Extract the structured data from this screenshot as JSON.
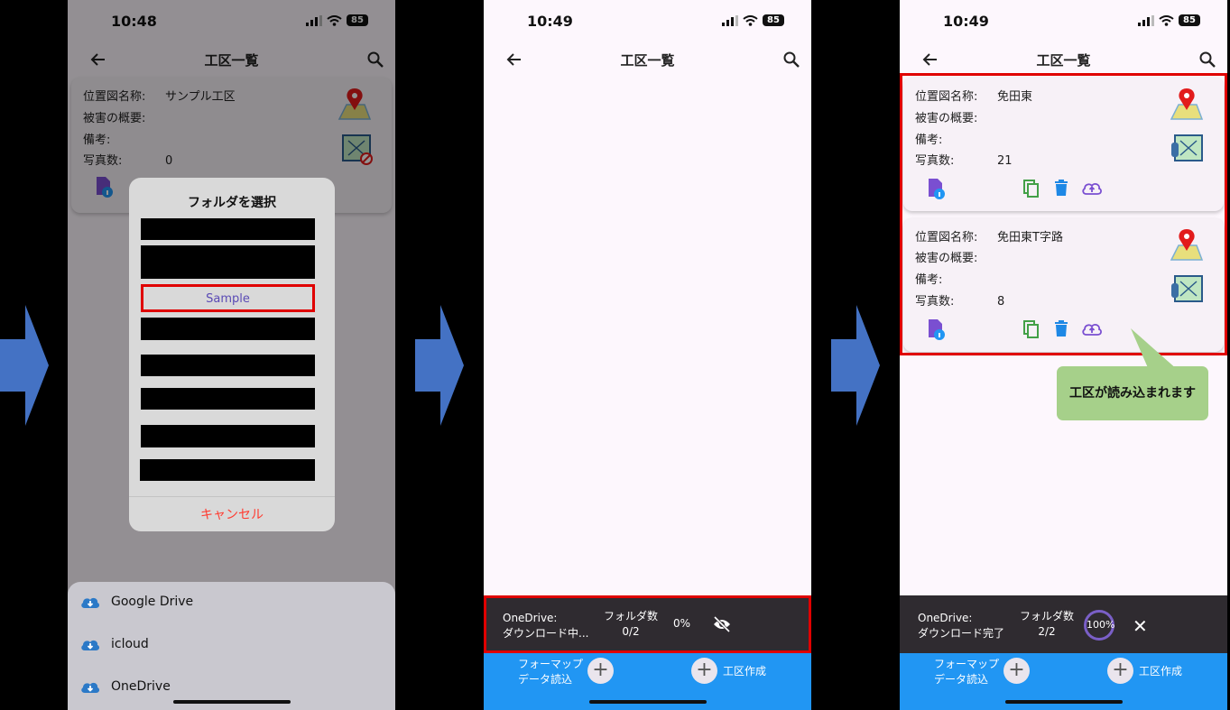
{
  "status": {
    "time1": "10:48",
    "time2": "10:49",
    "time3": "10:49",
    "battery": "85"
  },
  "appbar": {
    "title": "工区一覧"
  },
  "labels": {
    "map_name": "位置図名称:",
    "damage": "被害の概要:",
    "notes": "備考:",
    "photos": "写真数:"
  },
  "phone1": {
    "card": {
      "map_name": "サンプル工区",
      "photos": "0"
    },
    "dialog": {
      "title": "フォルダを選択",
      "selected": "Sample",
      "cancel": "キャンセル"
    },
    "sheet": {
      "items": [
        "Google Drive",
        "icloud",
        "OneDrive"
      ]
    }
  },
  "phone2": {
    "download": {
      "service": "OneDrive:",
      "status": "ダウンロード中...",
      "folders_label": "フォルダ数",
      "folders_value": "0/2",
      "percent": "0%"
    }
  },
  "phone3": {
    "cards": [
      {
        "map_name": "免田東",
        "photos": "21"
      },
      {
        "map_name": "免田東T字路",
        "photos": "8"
      }
    ],
    "callout": "工区が読み込まれます",
    "download": {
      "service": "OneDrive:",
      "status": "ダウンロード完了",
      "folders_label": "フォルダ数",
      "folders_value": "2/2",
      "percent": "100%"
    }
  },
  "bottom": {
    "format_line1": "フォーマップ",
    "format_line2": "データ読込",
    "create": "工区作成"
  },
  "colors": {
    "accent_blue": "#2196f3",
    "highlight_red": "#e00000",
    "callout_green": "#a6d08a",
    "arrow_blue": "#4472c4"
  },
  "icons": [
    "arrow-left-icon",
    "search-icon",
    "map-pin-icon",
    "map-photo-icon",
    "file-info-icon",
    "copy-icon",
    "trash-icon",
    "cloud-upload-icon",
    "cloud-download-icon",
    "eye-off-icon",
    "close-icon",
    "plus-icon"
  ]
}
